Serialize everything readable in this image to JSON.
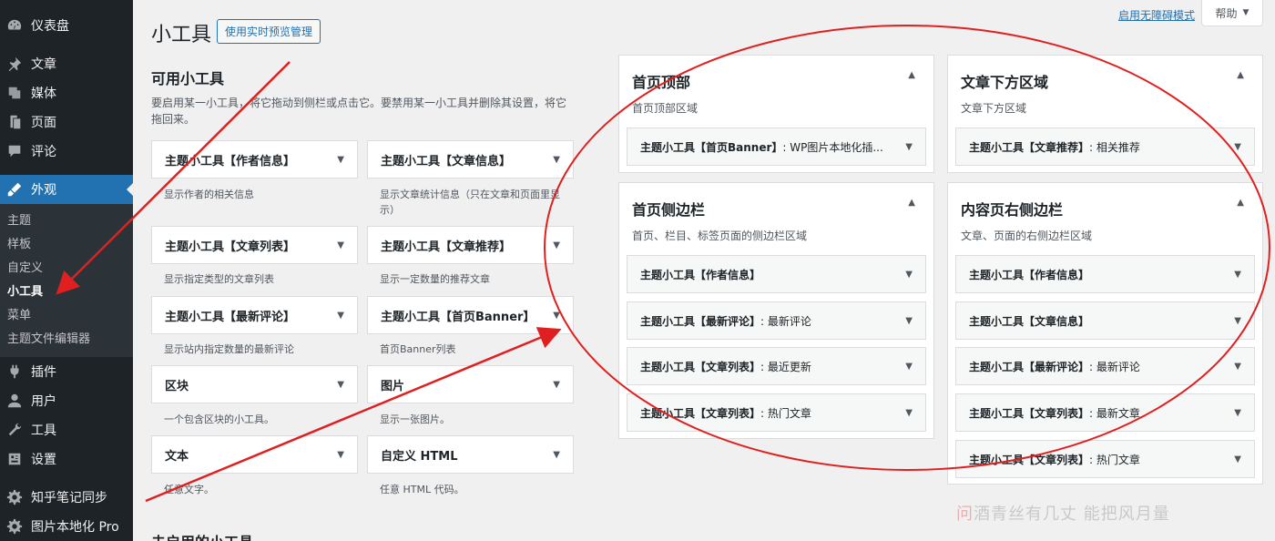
{
  "sidebar": {
    "items": [
      {
        "label": "仪表盘",
        "icon": "dashboard-icon"
      },
      {
        "label": "文章",
        "icon": "pin-icon"
      },
      {
        "label": "媒体",
        "icon": "media-icon"
      },
      {
        "label": "页面",
        "icon": "page-icon"
      },
      {
        "label": "评论",
        "icon": "comment-icon"
      },
      {
        "label": "外观",
        "icon": "appearance-icon"
      },
      {
        "label": "插件",
        "icon": "plugin-icon"
      },
      {
        "label": "用户",
        "icon": "user-icon"
      },
      {
        "label": "工具",
        "icon": "tools-icon"
      },
      {
        "label": "设置",
        "icon": "settings-icon"
      },
      {
        "label": "知乎笔记同步",
        "icon": "gear-icon"
      },
      {
        "label": "图片本地化 Pro",
        "icon": "gear-icon"
      }
    ],
    "submenu": [
      "主题",
      "样板",
      "自定义",
      "小工具",
      "菜单",
      "主题文件编辑器"
    ]
  },
  "topbar": {
    "accessibility": "启用无障碍模式",
    "help": "帮助"
  },
  "header": {
    "title": "小工具",
    "live_preview": "使用实时预览管理"
  },
  "available": {
    "heading": "可用小工具",
    "desc": "要启用某一小工具，将它拖动到侧栏或点击它。要禁用某一小工具并删除其设置，将它拖回来。",
    "widgets": [
      {
        "name": "主题小工具【作者信息】",
        "desc": "显示作者的相关信息"
      },
      {
        "name": "主题小工具【文章信息】",
        "desc": "显示文章统计信息（只在文章和页面里显示）"
      },
      {
        "name": "主题小工具【文章列表】",
        "desc": "显示指定类型的文章列表"
      },
      {
        "name": "主题小工具【文章推荐】",
        "desc": "显示一定数量的推荐文章"
      },
      {
        "name": "主题小工具【最新评论】",
        "desc": "显示站内指定数量的最新评论"
      },
      {
        "name": "主题小工具【首页Banner】",
        "desc": "首页Banner列表"
      },
      {
        "name": "区块",
        "desc": "一个包含区块的小工具。"
      },
      {
        "name": "图片",
        "desc": "显示一张图片。"
      },
      {
        "name": "文本",
        "desc": "任意文字。"
      },
      {
        "name": "自定义 HTML",
        "desc": "任意 HTML 代码。"
      }
    ]
  },
  "inactive": {
    "heading": "未启用的小工具"
  },
  "areas": {
    "home_top": {
      "title": "首页顶部",
      "desc": "首页顶部区域",
      "widgets": [
        {
          "main": "主题小工具【首页Banner】",
          "sub": ": WP图片本地化插..."
        }
      ]
    },
    "below_post": {
      "title": "文章下方区域",
      "desc": "文章下方区域",
      "widgets": [
        {
          "main": "主题小工具【文章推荐】",
          "sub": ": 相关推荐"
        }
      ]
    },
    "home_sidebar": {
      "title": "首页侧边栏",
      "desc": "首页、栏目、标签页面的侧边栏区域",
      "widgets": [
        {
          "main": "主题小工具【作者信息】",
          "sub": ""
        },
        {
          "main": "主题小工具【最新评论】",
          "sub": ": 最新评论"
        },
        {
          "main": "主题小工具【文章列表】",
          "sub": ": 最近更新"
        },
        {
          "main": "主题小工具【文章列表】",
          "sub": ": 热门文章"
        }
      ]
    },
    "content_sidebar": {
      "title": "内容页右侧边栏",
      "desc": "文章、页面的右侧边栏区域",
      "widgets": [
        {
          "main": "主题小工具【作者信息】",
          "sub": ""
        },
        {
          "main": "主题小工具【文章信息】",
          "sub": ""
        },
        {
          "main": "主题小工具【最新评论】",
          "sub": ": 最新评论"
        },
        {
          "main": "主题小工具【文章列表】",
          "sub": ": 最新文章"
        },
        {
          "main": "主题小工具【文章列表】",
          "sub": ": 热门文章"
        }
      ]
    }
  },
  "watermark": {
    "mark": "问",
    "text": "酒青丝有几丈  能把风月量"
  },
  "colors": {
    "accent": "#2271b1",
    "annotation": "#e02020"
  }
}
